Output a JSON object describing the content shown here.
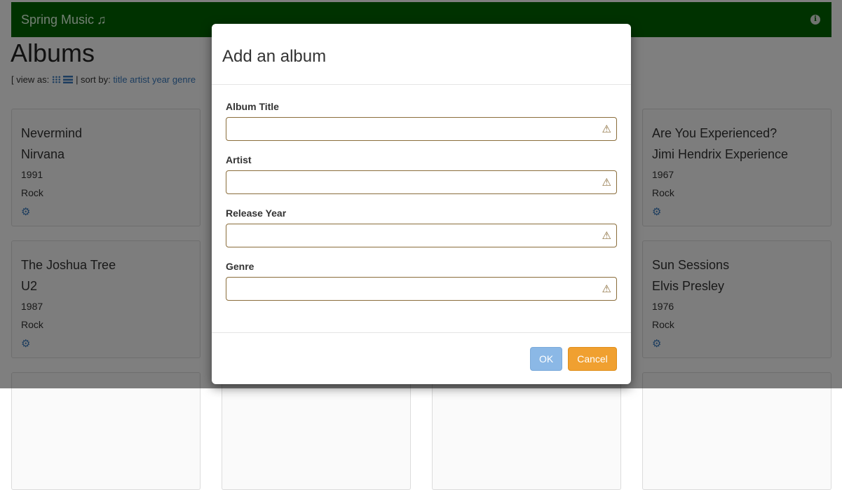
{
  "navbar": {
    "brand": "Spring Music",
    "brand_icon": "♫",
    "info_icon": "i"
  },
  "page": {
    "title": "Albums",
    "view_prefix": "[ view as:",
    "sort_prefix": "| sort by:",
    "sort_options": [
      "title",
      "artist",
      "year",
      "genre"
    ]
  },
  "albums": [
    {
      "title": "Nevermind",
      "artist": "Nirvana",
      "year": "1991",
      "genre": "Rock"
    },
    {
      "title": "Are You Experienced?",
      "artist": "Jimi Hendrix Experience",
      "year": "1967",
      "genre": "Rock"
    },
    {
      "title": "The Joshua Tree",
      "artist": "U2",
      "year": "1987",
      "genre": "Rock"
    },
    {
      "title": "Sun Sessions",
      "artist": "Elvis Presley",
      "year": "1976",
      "genre": "Rock"
    }
  ],
  "modal": {
    "title": "Add an album",
    "fields": [
      {
        "label": "Album Title",
        "value": ""
      },
      {
        "label": "Artist",
        "value": ""
      },
      {
        "label": "Release Year",
        "value": ""
      },
      {
        "label": "Genre",
        "value": ""
      }
    ],
    "ok_label": "OK",
    "cancel_label": "Cancel"
  },
  "colors": {
    "navbar": "#006400",
    "link": "#3a7bbf",
    "warning": "#8a6d3b",
    "ok": "#8bb8e6",
    "cancel": "#f0a030"
  }
}
